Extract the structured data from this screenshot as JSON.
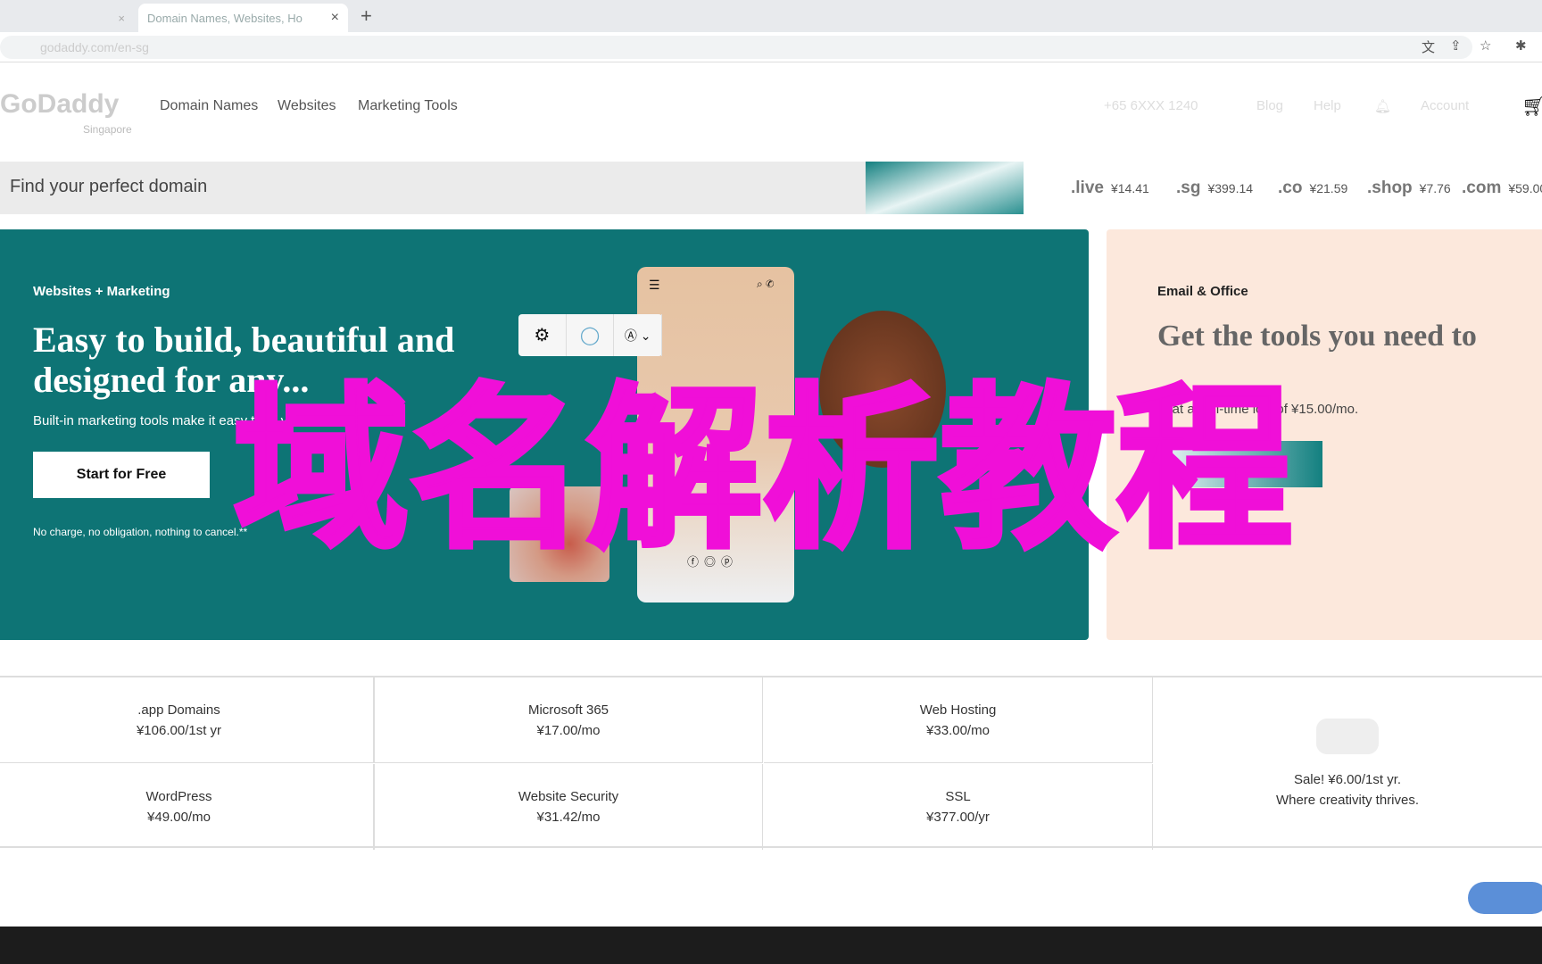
{
  "browser": {
    "active_tab": "Domain Names, Websites, Ho",
    "url": "godaddy.com/en-sg",
    "new_tab": "+",
    "close": "×"
  },
  "header": {
    "logo": "GoDaddy",
    "region": "Singapore",
    "nav": [
      "Domain Names",
      "Websites",
      "Marketing Tools"
    ],
    "phone": "+65 6XXX 1240",
    "blog": "Blog",
    "help": "Help",
    "account": "Account"
  },
  "search": {
    "placeholder": "Find your perfect domain"
  },
  "tlds": [
    {
      "name": ".live",
      "price": "¥14.41"
    },
    {
      "name": ".sg",
      "price": "¥399.14"
    },
    {
      "name": ".co",
      "price": "¥21.59"
    },
    {
      "name": ".shop",
      "price": "¥7.76"
    },
    {
      "name": ".com",
      "price": "¥59.00"
    }
  ],
  "hero": {
    "eyebrow": "Websites + Marketing",
    "title": "Easy to build, beautiful and designed for any...",
    "subtitle": "Built-in marketing tools make it easy to ... your site.",
    "cta": "Start for Free",
    "note": "No charge, no obligation, nothing to cancel.**"
  },
  "email_card": {
    "eyebrow": "Email & Office",
    "title": "Get the tools you need to",
    "subtitle": "... at an all-time low of ¥15.00/mo."
  },
  "products": [
    {
      "name": ".app Domains",
      "price": "¥106.00/1st yr"
    },
    {
      "name": "Microsoft 365",
      "price": "¥17.00/mo"
    },
    {
      "name": "Web Hosting",
      "price": "¥33.00/mo"
    },
    {
      "name": "WordPress",
      "price": "¥49.00/mo"
    },
    {
      "name": "Website Security",
      "price": "¥31.42/mo"
    },
    {
      "name": "SSL",
      "price": "¥377.00/yr"
    }
  ],
  "promo": {
    "line1": "Sale! ¥6.00/1st yr.",
    "line2": "Where creativity thrives."
  },
  "overlay": {
    "text": "域名解析教程",
    "color": "#f00fd8"
  },
  "colors": {
    "hero": "#0e7475",
    "peach": "#fce8dc"
  }
}
